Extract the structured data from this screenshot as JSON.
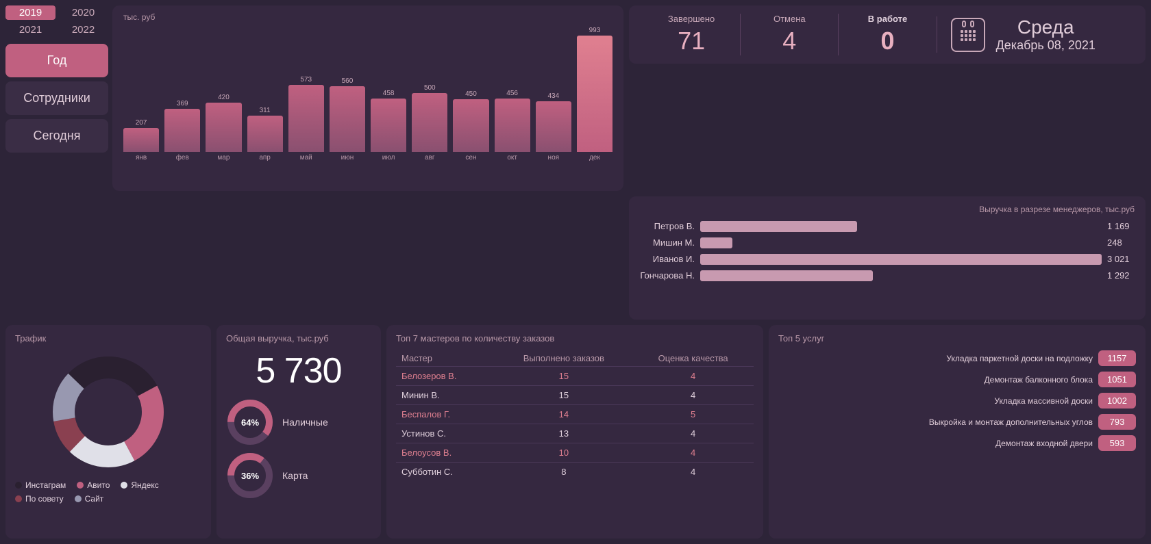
{
  "sidebar": {
    "years": [
      "2019",
      "2020",
      "2021",
      "2022"
    ],
    "active_year": "2019",
    "buttons": [
      {
        "label": "Год",
        "active": true
      },
      {
        "label": "Сотрудники",
        "active": false
      },
      {
        "label": "Сегодня",
        "active": false
      }
    ]
  },
  "chart": {
    "y_label": "тыс. руб",
    "bars": [
      {
        "month": "янв",
        "value": 207,
        "pct": 21
      },
      {
        "month": "фев",
        "value": 369,
        "pct": 37
      },
      {
        "month": "мар",
        "value": 420,
        "pct": 42
      },
      {
        "month": "апр",
        "value": 311,
        "pct": 31
      },
      {
        "month": "май",
        "value": 573,
        "pct": 57
      },
      {
        "month": "июн",
        "value": 560,
        "pct": 56
      },
      {
        "month": "июл",
        "value": 458,
        "pct": 46
      },
      {
        "month": "авг",
        "value": 500,
        "pct": 50
      },
      {
        "month": "сен",
        "value": 450,
        "pct": 45
      },
      {
        "month": "окт",
        "value": 456,
        "pct": 46
      },
      {
        "month": "ноя",
        "value": 434,
        "pct": 43
      },
      {
        "month": "дек",
        "value": 993,
        "pct": 99,
        "highlight": true
      }
    ]
  },
  "stats": {
    "completed_label": "Завершено",
    "cancelled_label": "Отмена",
    "inwork_label": "В работе",
    "completed_value": "71",
    "cancelled_value": "4",
    "inwork_value": "0"
  },
  "calendar": {
    "day": "Среда",
    "date": "Декабрь 08, 2021"
  },
  "managers": {
    "title": "Выручка в разрезе менеджеров, тыс.руб",
    "items": [
      {
        "name": "Петров В.",
        "value": "1 169",
        "pct": 39
      },
      {
        "name": "Мишин М.",
        "value": "248",
        "pct": 8
      },
      {
        "name": "Иванов И.",
        "value": "3 021",
        "pct": 100
      },
      {
        "name": "Гончарова Н.",
        "value": "1 292",
        "pct": 43
      }
    ]
  },
  "traffic": {
    "title": "Трафик",
    "segments": [
      {
        "label": "Инстаграм",
        "color": "#2a2030",
        "pct": 30
      },
      {
        "label": "Авито",
        "color": "#c06080",
        "pct": 25
      },
      {
        "label": "Яндекс",
        "color": "#e0e0e8",
        "pct": 20
      },
      {
        "label": "По совету",
        "color": "#8a4050",
        "pct": 10
      },
      {
        "label": "Сайт",
        "color": "#9898b0",
        "pct": 15
      }
    ]
  },
  "revenue": {
    "title": "Общая выручка, тыс.руб",
    "total": "5 730",
    "cash_label": "Наличные",
    "cash_pct": "64%",
    "card_label": "Карта",
    "card_pct": "36%"
  },
  "masters": {
    "title": "Топ 7 мастеров по количеству заказов",
    "col_master": "Мастер",
    "col_done": "Выполнено заказов",
    "col_quality": "Оценка качества",
    "rows": [
      {
        "name": "Белозеров В.",
        "done": "15",
        "quality": "4",
        "highlight": true
      },
      {
        "name": "Минин В.",
        "done": "15",
        "quality": "4",
        "highlight": false
      },
      {
        "name": "Беспалов Г.",
        "done": "14",
        "quality": "5",
        "highlight": true
      },
      {
        "name": "Устинов С.",
        "done": "13",
        "quality": "4",
        "highlight": false
      },
      {
        "name": "Белоусов В.",
        "done": "10",
        "quality": "4",
        "highlight": true
      },
      {
        "name": "Субботин С.",
        "done": "8",
        "quality": "4",
        "highlight": false
      }
    ]
  },
  "services": {
    "title": "Топ 5 услуг",
    "items": [
      {
        "name": "Укладка паркетной доски на подложку",
        "value": "1157"
      },
      {
        "name": "Демонтаж балконного блока",
        "value": "1051"
      },
      {
        "name": "Укладка массивной доски",
        "value": "1002"
      },
      {
        "name": "Выкройка и монтаж дополнительных углов",
        "value": "793"
      },
      {
        "name": "Демонтаж входной двери",
        "value": "593"
      }
    ]
  }
}
